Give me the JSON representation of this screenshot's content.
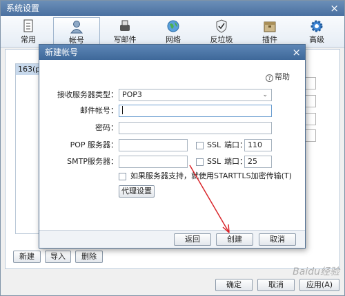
{
  "window": {
    "title": "系统设置",
    "close": "×"
  },
  "toolbar": {
    "items": [
      {
        "label": "常用",
        "icon": "general-icon"
      },
      {
        "label": "帐号",
        "icon": "account-icon"
      },
      {
        "label": "写邮件",
        "icon": "compose-icon"
      },
      {
        "label": "网络",
        "icon": "network-icon"
      },
      {
        "label": "反垃圾",
        "icon": "antispam-icon"
      },
      {
        "label": "插件",
        "icon": "plugin-icon"
      },
      {
        "label": "高级",
        "icon": "advanced-icon"
      }
    ]
  },
  "accounts": {
    "items": [
      "163(pl"
    ]
  },
  "account_buttons": {
    "new": "新建",
    "import": "导入",
    "delete": "删除"
  },
  "dialog": {
    "title": "新建帐号",
    "close": "×",
    "help": "帮助",
    "fields": {
      "server_type_label": "接收服务器类型：",
      "server_type_value": "POP3",
      "email_label": "邮件帐号：",
      "email_value": "",
      "password_label": "密码：",
      "password_value": "",
      "pop_label": "POP 服务器：",
      "pop_value": "",
      "pop_ssl": "SSL",
      "pop_port_label": "端口：",
      "pop_port": "110",
      "smtp_label": "SMTP服务器：",
      "smtp_value": "",
      "smtp_ssl": "SSL",
      "smtp_port_label": "端口：",
      "smtp_port": "25",
      "starttls": "如果服务器支持，就使用STARTTLS加密传输(T)",
      "proxy": "代理设置"
    },
    "footer": {
      "back": "返回",
      "create": "创建",
      "cancel": "取消"
    }
  },
  "window_footer": {
    "ok": "确定",
    "cancel": "取消",
    "apply": "应用(A)"
  },
  "watermark": "Baidu经验",
  "colors": {
    "arrow": "#d9262b",
    "title_bar": "#4a70a0",
    "selected": "#c8d9ec"
  }
}
